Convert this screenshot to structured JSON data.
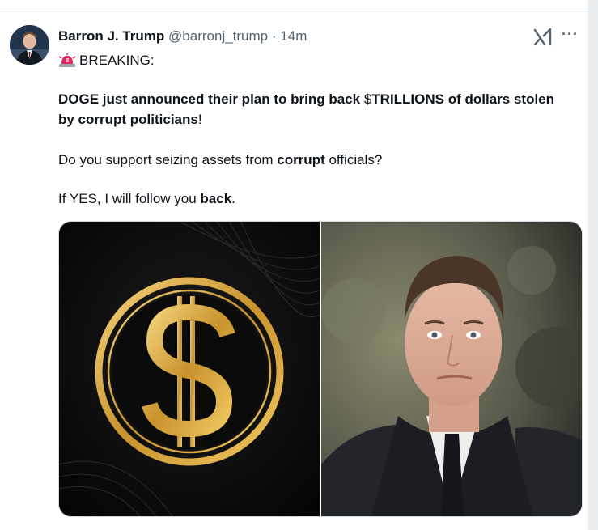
{
  "author": {
    "name": "Barron J. Trump",
    "handle": "@barronj_trump",
    "separator": "·",
    "time": "14m"
  },
  "tweet": {
    "line1": "BREAKING:",
    "para2_bold": "DOGE just announced their plan to bring back ",
    "para2_mid": "$",
    "para2_bold2": "TRILLIONS of dollars stolen by corrupt politicians",
    "para2_end": "!",
    "para3_pre": "Do you support seizing assets from ",
    "para3_bold": "corrupt",
    "para3_post": " officials?",
    "para4_pre": "If YES, I will follow you ",
    "para4_bold": "back",
    "para4_post": "."
  },
  "icons": {
    "siren": "police-light-emoji",
    "grok": "grok-icon",
    "more": "more-options-icon"
  },
  "actions": {
    "more_label": "···"
  },
  "colors": {
    "text": "#0f1419",
    "muted": "#536471",
    "gold": "#d4a93c",
    "border": "#cfd9de"
  }
}
